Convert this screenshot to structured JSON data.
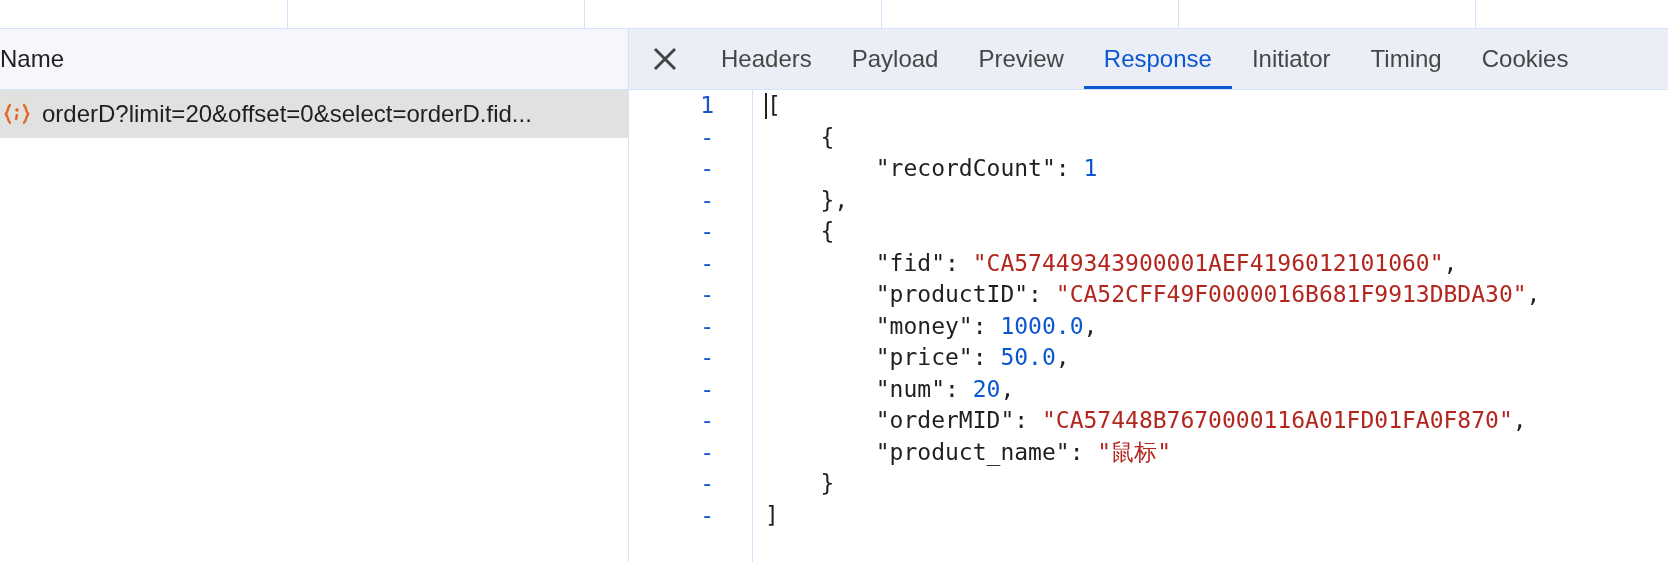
{
  "request_list": {
    "column_header": "Name",
    "rows": [
      {
        "name": "orderD?limit=20&offset=0&select=orderD.fid...",
        "selected": true
      }
    ]
  },
  "detail_tabs": [
    {
      "label": "Headers",
      "selected": false
    },
    {
      "label": "Payload",
      "selected": false
    },
    {
      "label": "Preview",
      "selected": false
    },
    {
      "label": "Response",
      "selected": true
    },
    {
      "label": "Initiator",
      "selected": false
    },
    {
      "label": "Timing",
      "selected": false
    },
    {
      "label": "Cookies",
      "selected": false
    }
  ],
  "response": {
    "lines": [
      {
        "number": "1",
        "segments": [
          {
            "kind": "punct",
            "text": "["
          }
        ]
      },
      {
        "number": "-",
        "segments": [
          {
            "kind": "punct",
            "text": "    {"
          }
        ]
      },
      {
        "number": "-",
        "segments": [
          {
            "kind": "key",
            "text": "        \"recordCount\": "
          },
          {
            "kind": "number",
            "text": "1"
          }
        ]
      },
      {
        "number": "-",
        "segments": [
          {
            "kind": "punct",
            "text": "    },"
          }
        ]
      },
      {
        "number": "-",
        "segments": [
          {
            "kind": "punct",
            "text": "    {"
          }
        ]
      },
      {
        "number": "-",
        "segments": [
          {
            "kind": "key",
            "text": "        \"fid\": "
          },
          {
            "kind": "string",
            "text": "\"CA57449343900001AEF4196012101060\""
          },
          {
            "kind": "punct",
            "text": ","
          }
        ]
      },
      {
        "number": "-",
        "segments": [
          {
            "kind": "key",
            "text": "        \"productID\": "
          },
          {
            "kind": "string",
            "text": "\"CA52CFF49F0000016B681F9913DBDA30\""
          },
          {
            "kind": "punct",
            "text": ","
          }
        ]
      },
      {
        "number": "-",
        "segments": [
          {
            "kind": "key",
            "text": "        \"money\": "
          },
          {
            "kind": "number",
            "text": "1000.0"
          },
          {
            "kind": "punct",
            "text": ","
          }
        ]
      },
      {
        "number": "-",
        "segments": [
          {
            "kind": "key",
            "text": "        \"price\": "
          },
          {
            "kind": "number",
            "text": "50.0"
          },
          {
            "kind": "punct",
            "text": ","
          }
        ]
      },
      {
        "number": "-",
        "segments": [
          {
            "kind": "key",
            "text": "        \"num\": "
          },
          {
            "kind": "number",
            "text": "20"
          },
          {
            "kind": "punct",
            "text": ","
          }
        ]
      },
      {
        "number": "-",
        "segments": [
          {
            "kind": "key",
            "text": "        \"orderMID\": "
          },
          {
            "kind": "string",
            "text": "\"CA57448B7670000116A01FD01FA0F870\""
          },
          {
            "kind": "punct",
            "text": ","
          }
        ]
      },
      {
        "number": "-",
        "segments": [
          {
            "kind": "key",
            "text": "        \"product_name\": "
          },
          {
            "kind": "string",
            "text": "\"鼠标\""
          }
        ]
      },
      {
        "number": "-",
        "segments": [
          {
            "kind": "punct",
            "text": "    }"
          }
        ]
      },
      {
        "number": "-",
        "segments": [
          {
            "kind": "punct",
            "text": "]"
          }
        ]
      }
    ]
  }
}
